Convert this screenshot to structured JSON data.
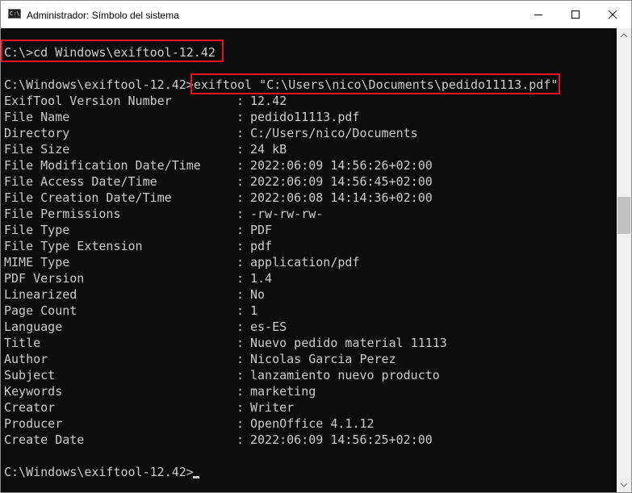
{
  "window": {
    "title": "Administrador: Símbolo del sistema",
    "icon_label": "C:\\"
  },
  "controls": {
    "minimize": "minimize-icon",
    "maximize": "maximize-icon",
    "close": "close-icon"
  },
  "console": {
    "cmd1": "C:\\>cd Windows\\exiftool-12.42",
    "prompt2": "C:\\Windows\\exiftool-12.42>",
    "command2": "exiftool \"C:\\Users\\nico\\Documents\\pedido11113.pdf\"",
    "rows": [
      {
        "key": "ExifTool Version Number",
        "value": "12.42"
      },
      {
        "key": "File Name",
        "value": "pedido11113.pdf"
      },
      {
        "key": "Directory",
        "value": "C:/Users/nico/Documents"
      },
      {
        "key": "File Size",
        "value": "24 kB"
      },
      {
        "key": "File Modification Date/Time",
        "value": "2022:06:09 14:56:26+02:00"
      },
      {
        "key": "File Access Date/Time",
        "value": "2022:06:09 14:56:45+02:00"
      },
      {
        "key": "File Creation Date/Time",
        "value": "2022:06:08 14:14:36+02:00"
      },
      {
        "key": "File Permissions",
        "value": "-rw-rw-rw-"
      },
      {
        "key": "File Type",
        "value": "PDF"
      },
      {
        "key": "File Type Extension",
        "value": "pdf"
      },
      {
        "key": "MIME Type",
        "value": "application/pdf"
      },
      {
        "key": "PDF Version",
        "value": "1.4"
      },
      {
        "key": "Linearized",
        "value": "No"
      },
      {
        "key": "Page Count",
        "value": "1"
      },
      {
        "key": "Language",
        "value": "es-ES"
      },
      {
        "key": "Title",
        "value": "Nuevo pedido material 11113"
      },
      {
        "key": "Author",
        "value": "Nicolas Garcia Perez"
      },
      {
        "key": "Subject",
        "value": "lanzamiento nuevo producto"
      },
      {
        "key": "Keywords",
        "value": "marketing"
      },
      {
        "key": "Creator",
        "value": "Writer"
      },
      {
        "key": "Producer",
        "value": "OpenOffice 4.1.12"
      },
      {
        "key": "Create Date",
        "value": "2022:06:09 14:56:25+02:00"
      }
    ],
    "final_prompt": "C:\\Windows\\exiftool-12.42>"
  },
  "colors": {
    "background": "#0c0c0c",
    "text": "#cccccc",
    "highlight": "#e81123"
  }
}
